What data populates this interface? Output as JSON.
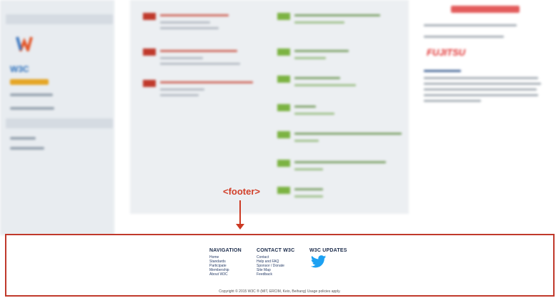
{
  "annotation": {
    "label": "<footer>"
  },
  "footer": {
    "navigation": {
      "heading": "NAVIGATION",
      "links": [
        "Home",
        "Standards",
        "Participate",
        "Membership",
        "About W3C"
      ]
    },
    "contact": {
      "heading": "CONTACT W3C",
      "links": [
        "Contact",
        "Help and FAQ",
        "Sponsor / Donate",
        "Site Map",
        "Feedback"
      ]
    },
    "updates": {
      "heading": "W3C UPDATES",
      "icon": "twitter-icon"
    },
    "copyright": "Copyright © 2015 W3C ® (MIT, ERCIM, Keio, Beihang) Usage policies apply."
  },
  "colors": {
    "annotation": "#cc3a24",
    "footer_border": "#c0392b",
    "twitter": "#1da1f2"
  }
}
